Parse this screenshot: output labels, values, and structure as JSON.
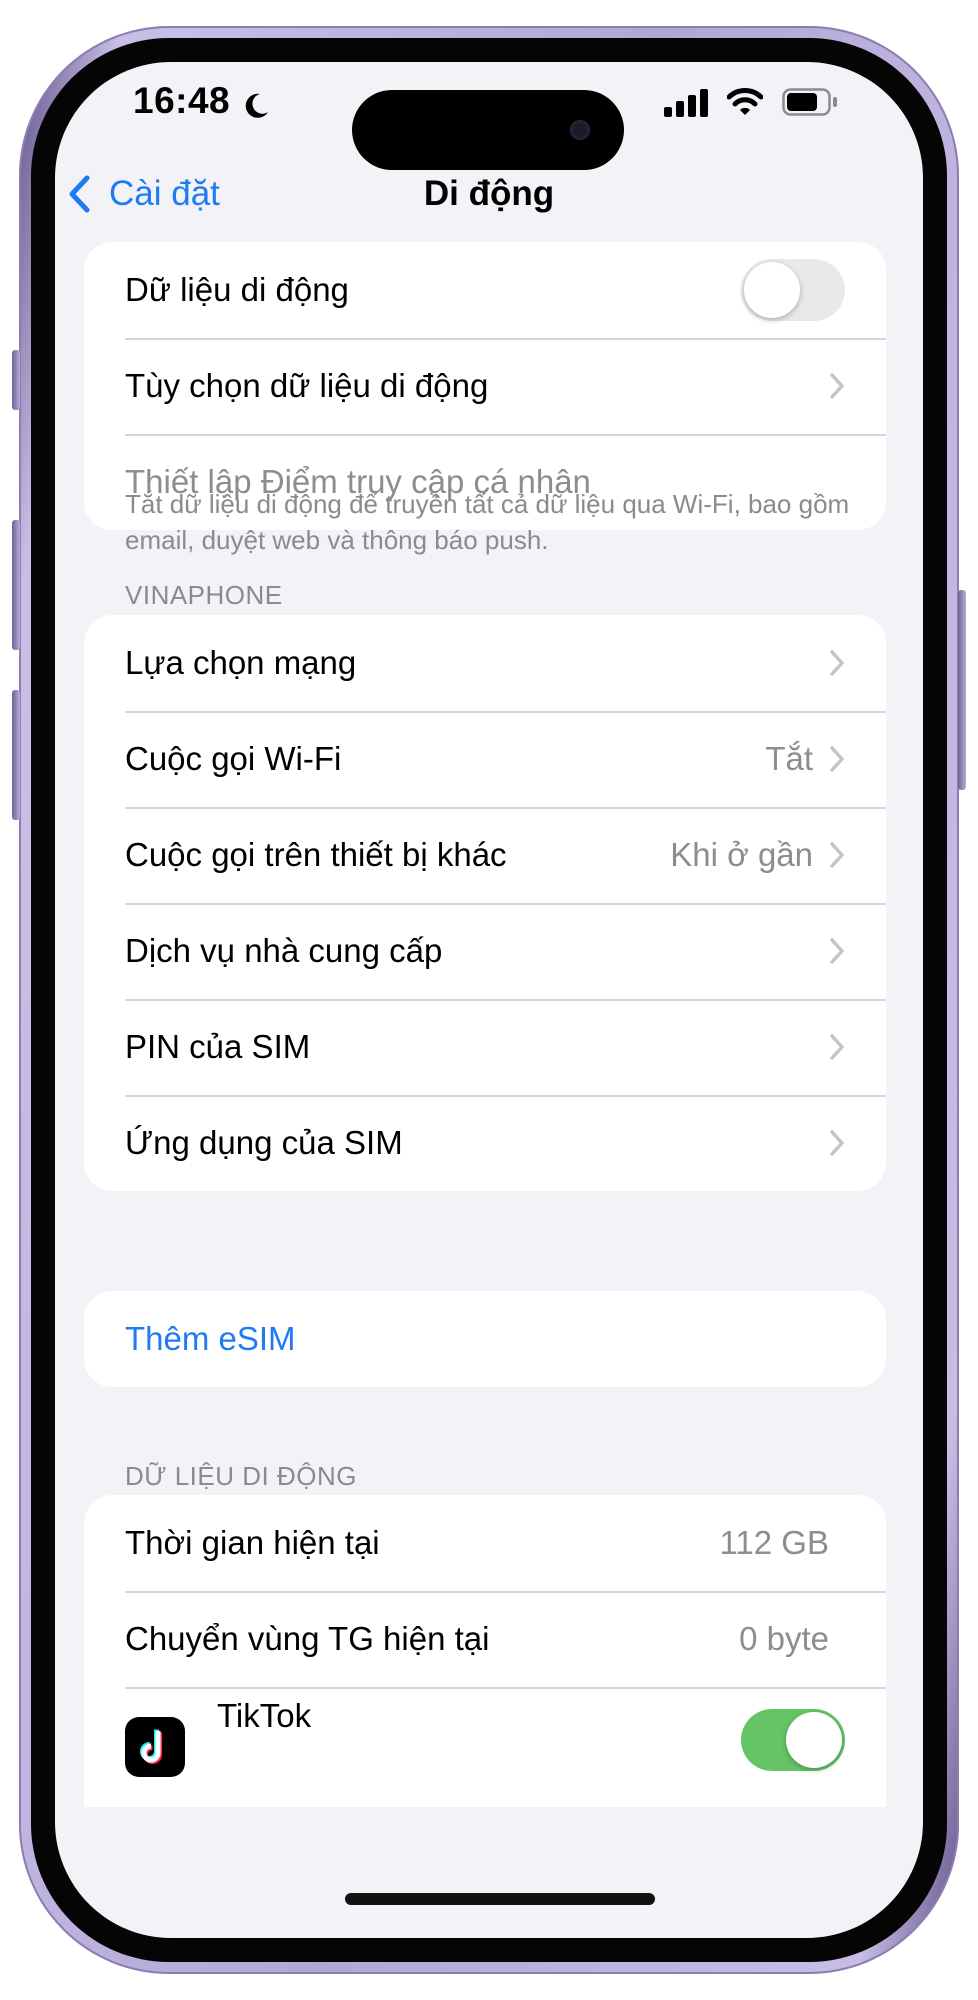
{
  "status_bar": {
    "time": "16:48"
  },
  "nav": {
    "back_label": "Cài đặt",
    "title": "Di động"
  },
  "group1": {
    "mobile_data_label": "Dữ liệu di động",
    "mobile_data_on": false,
    "data_options_label": "Tùy chọn dữ liệu di động",
    "hotspot_label": "Thiết lập Điểm truy cập cá nhân"
  },
  "group1_footer": "Tắt dữ liệu di động để truyền tất cả dữ liệu qua Wi-Fi, bao gồm email, duyệt web và thông báo push.",
  "carrier_section": {
    "header": "VINAPHONE",
    "items": [
      {
        "label": "Lựa chọn mạng",
        "value": ""
      },
      {
        "label": "Cuộc gọi Wi-Fi",
        "value": "Tắt"
      },
      {
        "label": "Cuộc gọi trên thiết bị khác",
        "value": "Khi ở gần"
      },
      {
        "label": "Dịch vụ nhà cung cấp",
        "value": ""
      },
      {
        "label": "PIN của SIM",
        "value": ""
      },
      {
        "label": "Ứng dụng của SIM",
        "value": ""
      }
    ]
  },
  "esim": {
    "add_label": "Thêm eSIM"
  },
  "usage_section": {
    "header": "DỮ LIỆU DI ĐỘNG",
    "items": [
      {
        "label": "Thời gian hiện tại",
        "value": "112 GB"
      },
      {
        "label": "Chuyển vùng TG hiện tại",
        "value": "0 byte"
      }
    ]
  },
  "apps": [
    {
      "name": "TikTok",
      "enabled": true,
      "icon": "tiktok-icon"
    }
  ],
  "colors": {
    "accent": "#1f7bf2",
    "toggle_on": "#65c466",
    "frame": "#b2a6d6",
    "background": "#f2f2f7"
  }
}
